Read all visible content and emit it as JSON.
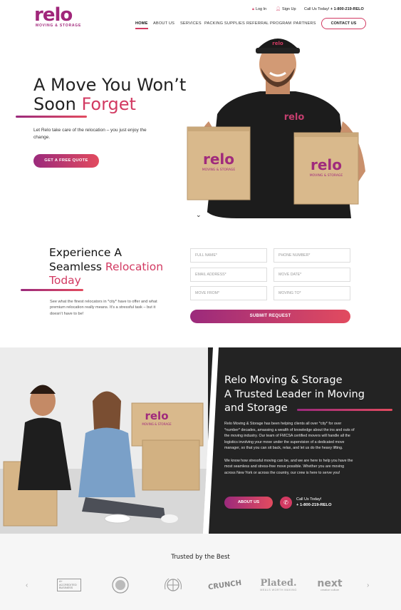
{
  "brand": {
    "name": "relo",
    "tagline": "MOVING & STORAGE",
    "accent": "#d23a62",
    "accent_dark": "#9b2a7c"
  },
  "utility": {
    "login": "Log In",
    "signup": "Sign Up",
    "call_label": "Call Us Today!",
    "call_number": "+ 1-800-219-RELO"
  },
  "nav": {
    "items": [
      "HOME",
      "ABOUT US",
      "SERVICES",
      "PACKING SUPPLIES",
      "REFERRAL PROGRAM",
      "PARTNERS"
    ],
    "active": "HOME",
    "contact": "CONTACT US"
  },
  "hero": {
    "title_line1": "A Move You Won’t",
    "title_line2_plain": "Soon ",
    "title_line2_accent": "Forget",
    "text": "Let Relo take care of the relocation – you just enjoy the change.",
    "cta": "GET A FREE QUOTE",
    "box_brand": "relo",
    "box_tagline": "MOVING & STORAGE"
  },
  "quote_form": {
    "title_line1": "Experience A",
    "title_line2_plain": "Seamless ",
    "title_line2_accent": "Relocation",
    "title_line3_accent": "Today",
    "text": "See what the finest relocators in *city* have to offer and what premium relocation really means. It’s a stressful task – but it doesn’t have to be!",
    "fields": {
      "full_name": "FULL NAME*",
      "phone": "PHONE NUMBER*",
      "email": "EMAIL ADDRESS*",
      "move_date": "MOVE DATE*",
      "move_from": "MOVE FROM*",
      "move_to": "MOVING TO*"
    },
    "submit": "SUBMIT REQUEST"
  },
  "about": {
    "title_line1": "Relo Moving & Storage",
    "title_line2": "A Trusted Leader in Moving",
    "title_line3": "and Storage",
    "para1": "Relo Moving & Storage has been helping clients all over *city* for over *number* decades, amassing a wealth of knowledge about the ins and outs of the moving industry. Our team of FMCSA certified movers will handle all the logistics involving your move under the supervision of a dedicated move manager, so that you can sit back, relax, and let us do the heavy lifting.",
    "para2": "We know how stressful moving can be, and we are here to help you have the most seamless and stress-free move possible. Whether you are moving across New York or across the country, our crew is here to serve you!",
    "cta": "ABOUT US",
    "call_label": "Call Us Today!",
    "call_number": "+ 1-800-219-RELO"
  },
  "trusted": {
    "title": "Trusted by the Best",
    "logos": [
      {
        "name": "bbb-accredited",
        "text": "A+ ACCREDITED BUSINESS"
      },
      {
        "name": "government-seal",
        "text": ""
      },
      {
        "name": "un-emblem",
        "text": ""
      },
      {
        "name": "crunch",
        "text": "CRUNCH"
      },
      {
        "name": "plated",
        "text": "Plated.",
        "sub": "MEALS WORTH MAKING"
      },
      {
        "name": "next",
        "text": "next",
        "sub": "creation·culture"
      }
    ]
  }
}
